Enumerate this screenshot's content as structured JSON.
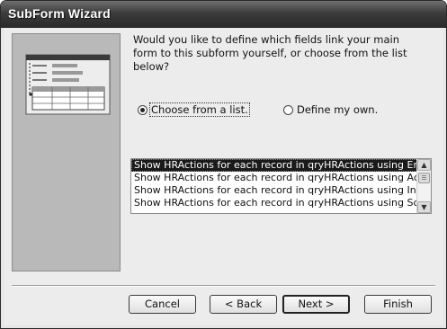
{
  "window": {
    "title": "SubForm Wizard"
  },
  "question": "Would you like to define which fields link your main form to this subform yourself, or choose from the list below?",
  "options": {
    "choose_label": "Choose from a list.",
    "define_label": "Define my own.",
    "selected": "choose"
  },
  "list": {
    "items": [
      "Show HRActions for each record in qryHRActions using EmployeeID",
      "Show HRActions for each record in qryHRActions using ActionType",
      "Show HRActions for each record in qryHRActions using InitiatedBy",
      "Show HRActions for each record in qryHRActions using ScheduledBy"
    ],
    "selected_index": 0
  },
  "buttons": {
    "cancel": "Cancel",
    "back": "< Back",
    "next": "Next >",
    "finish": "Finish"
  },
  "icons": [
    "radio-selected-icon",
    "radio-unselected-icon",
    "scroll-up-icon",
    "scroll-down-icon",
    "form-illustration-icon"
  ]
}
